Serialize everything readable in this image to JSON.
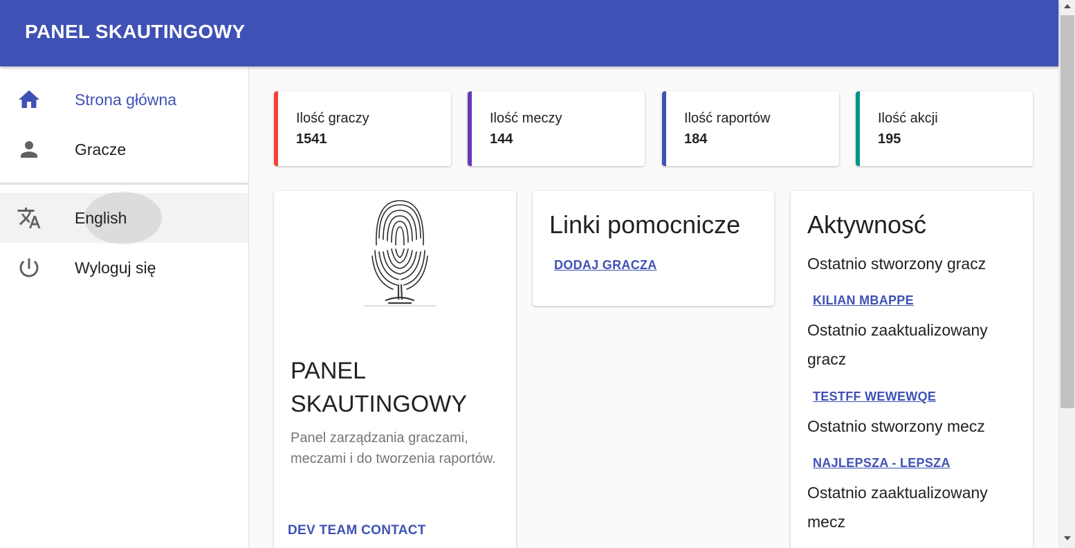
{
  "appbar": {
    "title": "PANEL SKAUTINGOWY"
  },
  "sidebar": {
    "items": [
      {
        "label": "Strona główna",
        "icon": "home-icon",
        "active": true
      },
      {
        "label": "Gracze",
        "icon": "person-icon"
      },
      {
        "label": "English",
        "icon": "translate-icon"
      },
      {
        "label": "Wyloguj się",
        "icon": "power-icon"
      }
    ]
  },
  "stats": [
    {
      "label": "Ilość graczy",
      "value": "1541",
      "color": "#f44336"
    },
    {
      "label": "Ilość meczy",
      "value": "144",
      "color": "#673ab7"
    },
    {
      "label": "Ilość raportów",
      "value": "184",
      "color": "#3f51b5"
    },
    {
      "label": "Ilość akcji",
      "value": "195",
      "color": "#009688"
    }
  ],
  "panel_card": {
    "title": "PANEL SKAUTINGOWY",
    "description": "Panel zarządzania graczami, meczami i do tworzenia raportów.",
    "action": "DEV TEAM CONTACT"
  },
  "links_card": {
    "title": "Linki pomocnicze",
    "links": [
      "DODAJ GRACZA"
    ]
  },
  "activity_card": {
    "title": "Aktywnosć",
    "items": [
      {
        "label": "Ostatnio stworzony gracz",
        "link": "KILIAN MBAPPE"
      },
      {
        "label": "Ostatnio zaaktualizowany gracz",
        "link": "TESTFF WEWEWQE"
      },
      {
        "label": "Ostatnio stworzony mecz",
        "link": "NAJLEPSZA - LEPSZA"
      },
      {
        "label": "Ostatnio zaaktualizowany mecz"
      }
    ]
  },
  "colors": {
    "primary": "#3f51b5",
    "background": "#fafafa"
  }
}
